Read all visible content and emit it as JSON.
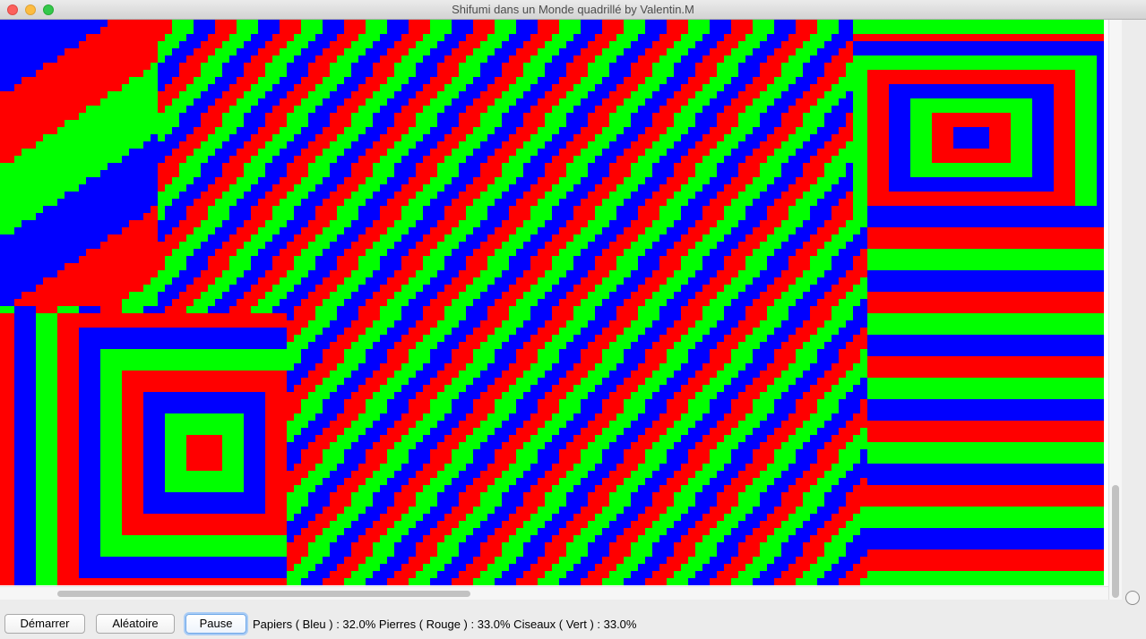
{
  "window": {
    "title": "Shifumi dans un Monde quadrillé by Valentin.M"
  },
  "grid": {
    "colors": {
      "papier": "#0000ff",
      "pierre": "#ff0000",
      "ciseaux": "#00ff00"
    }
  },
  "controls": {
    "start_label": "Démarrer",
    "random_label": "Aléatoire",
    "pause_label": "Pause"
  },
  "stats": {
    "text": "Papiers ( Bleu ) : 32.0% Pierres ( Rouge ) : 33.0% Ciseaux ( Vert ) : 33.0%"
  },
  "icons": {
    "close": "close-icon",
    "minimize": "minimize-icon",
    "zoom": "zoom-icon"
  }
}
